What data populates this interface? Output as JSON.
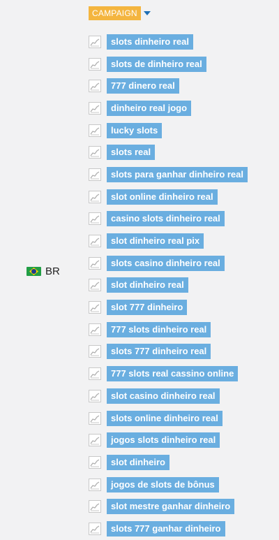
{
  "country": {
    "code": "BR",
    "flag_icon": "brazil-flag-icon"
  },
  "campaign": {
    "label": "CAMPAIGN",
    "accent": "#f4b53f",
    "dropdown_icon": "caret-down-icon"
  },
  "keywords": [
    "slots dinheiro real",
    "slots de dinheiro real",
    "777 dinero real",
    "dinheiro real jogo",
    "lucky slots",
    "slots real",
    "slots para ganhar dinheiro real",
    "slot online dinheiro real",
    "casino slots dinheiro real",
    "slot dinheiro real pix",
    "slots casino dinheiro real",
    "slot dinheiro real",
    "slot 777 dinheiro",
    "777 slots dinheiro real",
    "slots 777 dinheiro real",
    "777 slots real cassino online",
    "slot casino dinheiro real",
    "slots online dinheiro real",
    "jogos slots dinheiro real",
    "slot dinheiro",
    "jogos de slots de bônus",
    "slot mestre ganhar dinheiro",
    "slots 777 ganhar dinheiro"
  ],
  "keyword_color": "#6aaee0",
  "row_icon": "trend-chart-icon"
}
